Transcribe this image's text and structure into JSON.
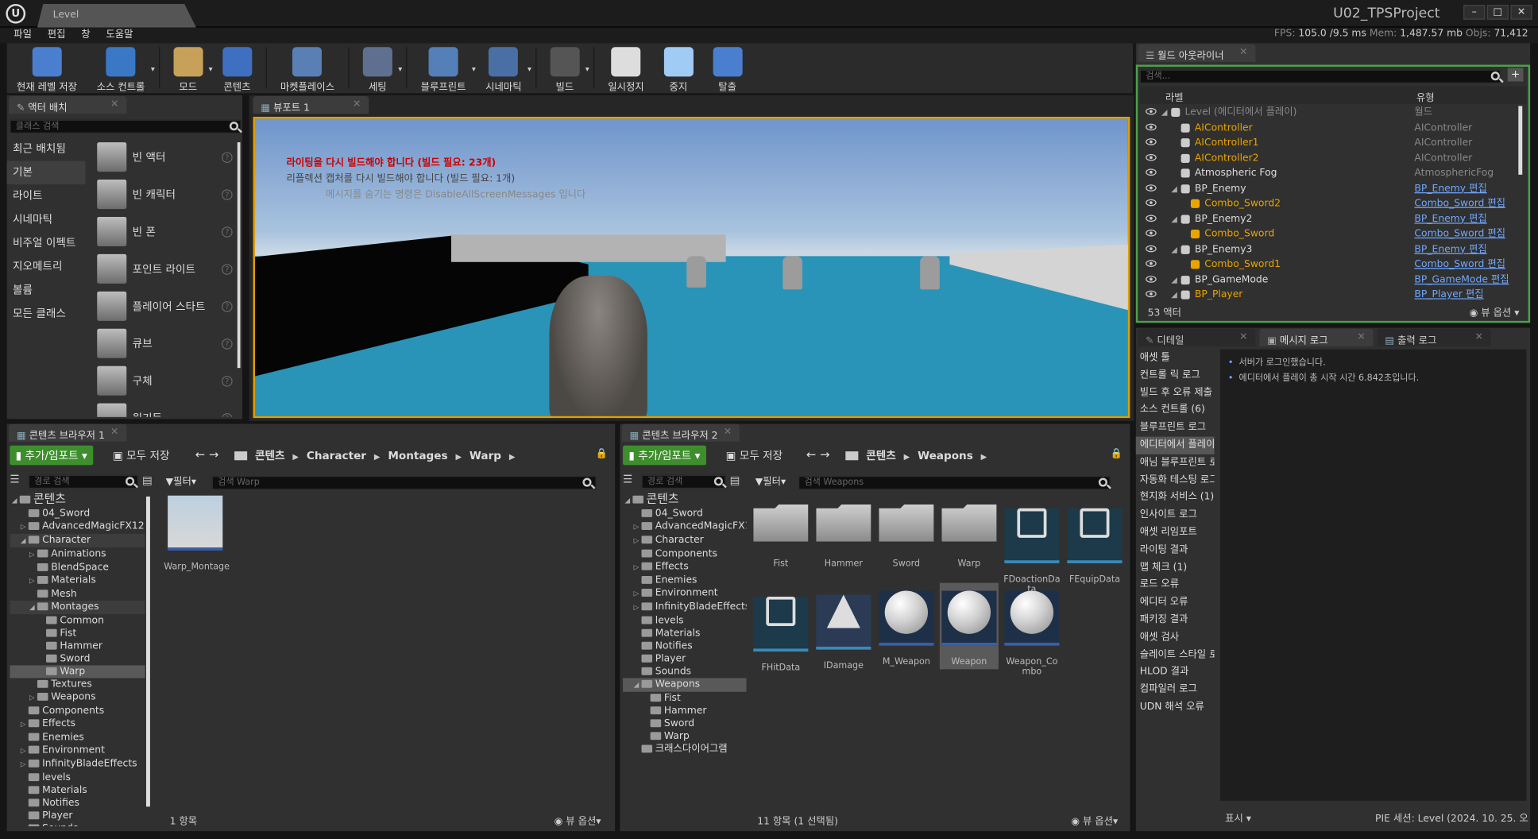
{
  "titlebar": {
    "level_tab": "Level",
    "project": "U02_TPSProject"
  },
  "menu": [
    "파일",
    "편집",
    "창",
    "도움말"
  ],
  "stats": {
    "fps_label": "FPS:",
    "fps": "105.0",
    "ms": "/9.5 ms",
    "mem_label": "Mem:",
    "mem": "1,487.57 mb",
    "objs_label": "Objs:",
    "objs": "71,412"
  },
  "toolbar": [
    {
      "label": "현재 레벨 저장",
      "icon": "save-icon",
      "color": "#4a7fd0"
    },
    {
      "label": "소스 컨트롤",
      "icon": "source-control-icon",
      "color": "#3a78c6"
    },
    {
      "label": "모드",
      "icon": "modes-icon",
      "color": "#c7a15a"
    },
    {
      "label": "콘텐츠",
      "icon": "content-icon",
      "color": "#3e6fc0"
    },
    {
      "label": "마켓플레이스",
      "icon": "marketplace-icon",
      "color": "#5a7fb5"
    },
    {
      "label": "세팅",
      "icon": "settings-icon",
      "color": "#5f6f8f"
    },
    {
      "label": "블루프린트",
      "icon": "blueprint-icon",
      "color": "#557fb8"
    },
    {
      "label": "시네마틱",
      "icon": "cinematics-icon",
      "color": "#4a6fa5"
    },
    {
      "label": "빌드",
      "icon": "build-icon",
      "color": "#555555"
    },
    {
      "label": "일시정지",
      "icon": "pause-icon",
      "color": "#dddddd"
    },
    {
      "label": "중지",
      "icon": "stop-icon",
      "color": "#9fcbf5"
    },
    {
      "label": "탈출",
      "icon": "eject-icon",
      "color": "#4a7fd0"
    }
  ],
  "place": {
    "tab": "액터 배치",
    "search_placeholder": "클래스 검색",
    "categories": [
      "최근 배치됨",
      "기본",
      "라이트",
      "시네마틱",
      "비주얼 이펙트",
      "지오메트리",
      "볼륨",
      "모든 클래스"
    ],
    "selected_category": "기본",
    "items": [
      "빈 액터",
      "빈 캐릭터",
      "빈 폰",
      "포인트 라이트",
      "플레이어 스타트",
      "큐브",
      "구체",
      "원기둥"
    ]
  },
  "viewport": {
    "tab": "뷰포트 1",
    "msg1": "라이팅을 다시 빌드해야 합니다 (빌드 필요: 23개)",
    "msg2": "리플렉션 캡처를 다시 빌드해야 합니다 (빌드 필요: 1개)",
    "msg3": "메시지를 숨기는 명령은 DisableAllScreenMessages 입니다"
  },
  "outliner": {
    "tab": "월드 아웃라이너",
    "search_placeholder": "검색...",
    "col_label": "라벨",
    "col_type": "유형",
    "count": "53 액터",
    "view_options": "뷰 옵션",
    "rows": [
      {
        "name": "Level (에디터에서 플레이)",
        "type": "월드",
        "indent": 0,
        "link": false,
        "dim": true
      },
      {
        "name": "AIController",
        "type": "AIController",
        "indent": 1,
        "link": false
      },
      {
        "name": "AIController1",
        "type": "AIController",
        "indent": 1,
        "link": false
      },
      {
        "name": "AIController2",
        "type": "AIController",
        "indent": 1,
        "link": false
      },
      {
        "name": "Atmospheric Fog",
        "type": "AtmosphericFog",
        "indent": 1,
        "link": false,
        "white": true
      },
      {
        "name": "BP_Enemy",
        "type": "BP_Enemy 편집",
        "indent": 1,
        "link": true,
        "white": true
      },
      {
        "name": "Combo_Sword2",
        "type": "Combo_Sword 편집",
        "indent": 2,
        "link": true
      },
      {
        "name": "BP_Enemy2",
        "type": "BP_Enemy 편집",
        "indent": 1,
        "link": true,
        "white": true
      },
      {
        "name": "Combo_Sword",
        "type": "Combo_Sword 편집",
        "indent": 2,
        "link": true
      },
      {
        "name": "BP_Enemy3",
        "type": "BP_Enemy 편집",
        "indent": 1,
        "link": true,
        "white": true
      },
      {
        "name": "Combo_Sword1",
        "type": "Combo_Sword 편집",
        "indent": 2,
        "link": true
      },
      {
        "name": "BP_GameMode",
        "type": "BP_GameMode 편집",
        "indent": 1,
        "link": true,
        "white": true
      },
      {
        "name": "BP_Player",
        "type": "BP_Player 편집",
        "indent": 1,
        "link": true
      }
    ]
  },
  "log": {
    "tabs": [
      "디테일",
      "메시지 로그",
      "출력 로그"
    ],
    "categories": [
      "애셋 툴",
      "컨트롤 릭 로그",
      "빌드 후 오류 제출",
      "소스 컨트롤 (6)",
      "블루프린트 로그",
      "에디터에서 플레이",
      "애님 블루프린트 로",
      "자동화 테스팅 로그",
      "현지화 서비스 (1)",
      "인사이트 로그",
      "애셋 리임포트",
      "라이팅 결과",
      "맵 체크 (1)",
      "로드 오류",
      "에디터 오류",
      "패키징 결과",
      "애셋 검사",
      "슬레이트 스타일 로",
      "HLOD 결과",
      "컴파일러 로그",
      "UDN 해석 오류"
    ],
    "selected": "에디터에서 플레이",
    "messages": [
      "서버가 로그인했습니다.",
      "에디터에서 플레이 총 시작 시간 6.842초입니다."
    ],
    "show": "표시",
    "footer": "PIE 세션: Level (2024. 10. 25. 오후"
  },
  "cb1": {
    "tab": "콘텐츠 브라우저 1",
    "add_import": "추가/임포트",
    "save_all": "모두 저장",
    "path": [
      "콘텐츠",
      "Character",
      "Montages",
      "Warp"
    ],
    "path_search": "경로 검색",
    "filter": "필터",
    "asset_search": "검색 Warp",
    "assets": [
      "Warp_Montage"
    ],
    "count": "1 항목",
    "view_options": "뷰 옵션",
    "tree": [
      {
        "t": "콘텐츠",
        "d": 0,
        "root": true
      },
      {
        "t": "04_Sword",
        "d": 1
      },
      {
        "t": "AdvancedMagicFX12",
        "d": 1,
        "ar": "▷"
      },
      {
        "t": "Character",
        "d": 1,
        "ar": "◢",
        "hl": true
      },
      {
        "t": "Animations",
        "d": 2,
        "ar": "▷"
      },
      {
        "t": "BlendSpace",
        "d": 2
      },
      {
        "t": "Materials",
        "d": 2,
        "ar": "▷"
      },
      {
        "t": "Mesh",
        "d": 2
      },
      {
        "t": "Montages",
        "d": 2,
        "ar": "◢",
        "hl": true
      },
      {
        "t": "Common",
        "d": 3
      },
      {
        "t": "Fist",
        "d": 3
      },
      {
        "t": "Hammer",
        "d": 3
      },
      {
        "t": "Sword",
        "d": 3
      },
      {
        "t": "Warp",
        "d": 3,
        "sel": true
      },
      {
        "t": "Textures",
        "d": 2
      },
      {
        "t": "Weapons",
        "d": 2,
        "ar": "▷"
      },
      {
        "t": "Components",
        "d": 1
      },
      {
        "t": "Effects",
        "d": 1,
        "ar": "▷"
      },
      {
        "t": "Enemies",
        "d": 1
      },
      {
        "t": "Environment",
        "d": 1,
        "ar": "▷"
      },
      {
        "t": "InfinityBladeEffects",
        "d": 1,
        "ar": "▷"
      },
      {
        "t": "levels",
        "d": 1
      },
      {
        "t": "Materials",
        "d": 1
      },
      {
        "t": "Notifies",
        "d": 1
      },
      {
        "t": "Player",
        "d": 1
      },
      {
        "t": "Sounds",
        "d": 1
      }
    ]
  },
  "cb2": {
    "tab": "콘텐츠 브라우저 2",
    "add_import": "추가/임포트",
    "save_all": "모두 저장",
    "path": [
      "콘텐츠",
      "Weapons"
    ],
    "path_search": "경로 검색",
    "filter": "필터",
    "asset_search": "검색 Weapons",
    "count": "11 항목 (1 선택됨)",
    "view_options": "뷰 옵션",
    "assets": [
      {
        "n": "Fist",
        "k": "folder"
      },
      {
        "n": "Hammer",
        "k": "folder"
      },
      {
        "n": "Sword",
        "k": "folder"
      },
      {
        "n": "Warp",
        "k": "folder"
      },
      {
        "n": "FDoactionData",
        "k": "bp"
      },
      {
        "n": "FEquipData",
        "k": "bp"
      },
      {
        "n": "FHitData",
        "k": "bp"
      },
      {
        "n": "IDamage",
        "k": "iface"
      },
      {
        "n": "M_Weapon",
        "k": "sph"
      },
      {
        "n": "Weapon",
        "k": "sph",
        "sel": true
      },
      {
        "n": "Weapon_Combo",
        "k": "sph"
      }
    ],
    "tree": [
      {
        "t": "콘텐츠",
        "d": 0,
        "root": true
      },
      {
        "t": "04_Sword",
        "d": 1
      },
      {
        "t": "AdvancedMagicFX1",
        "d": 1,
        "ar": "▷"
      },
      {
        "t": "Character",
        "d": 1,
        "ar": "▷"
      },
      {
        "t": "Components",
        "d": 1
      },
      {
        "t": "Effects",
        "d": 1,
        "ar": "▷"
      },
      {
        "t": "Enemies",
        "d": 1
      },
      {
        "t": "Environment",
        "d": 1,
        "ar": "▷"
      },
      {
        "t": "InfinityBladeEffects",
        "d": 1,
        "ar": "▷"
      },
      {
        "t": "levels",
        "d": 1
      },
      {
        "t": "Materials",
        "d": 1
      },
      {
        "t": "Notifies",
        "d": 1
      },
      {
        "t": "Player",
        "d": 1
      },
      {
        "t": "Sounds",
        "d": 1
      },
      {
        "t": "Weapons",
        "d": 1,
        "ar": "◢",
        "sel": true
      },
      {
        "t": "Fist",
        "d": 2
      },
      {
        "t": "Hammer",
        "d": 2
      },
      {
        "t": "Sword",
        "d": 2
      },
      {
        "t": "Warp",
        "d": 2
      },
      {
        "t": "크래스다이어그램",
        "d": 1
      }
    ]
  }
}
